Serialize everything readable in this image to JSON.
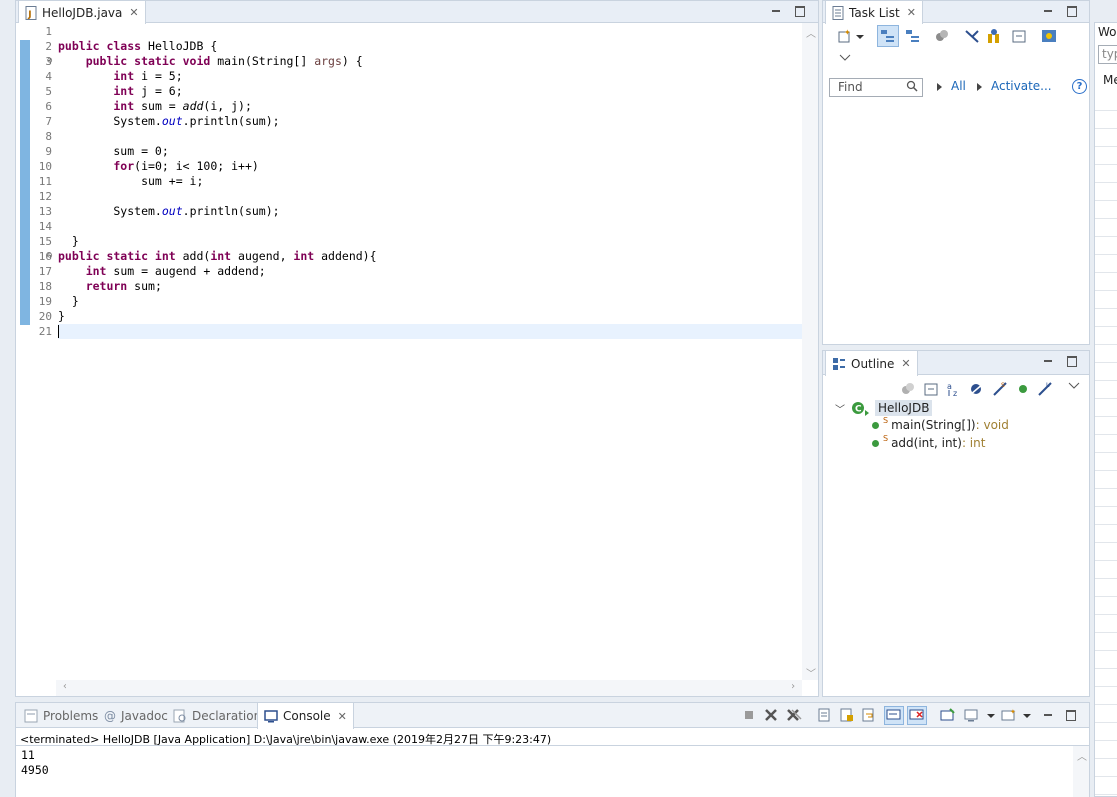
{
  "editor": {
    "tab_label": "HelloJDB.java",
    "line_numbers": [
      "1",
      "2",
      "3",
      "4",
      "5",
      "6",
      "7",
      "8",
      "9",
      "10",
      "11",
      "12",
      "13",
      "14",
      "15",
      "16",
      "17",
      "18",
      "19",
      "20",
      "21"
    ],
    "code": {
      "l2a": "public class",
      "l2b": " HelloJDB {",
      "l3a": "    public static void",
      "l3b": " main(String[] ",
      "l3c": "args",
      "l3d": ") {",
      "l4a": "        int",
      "l4b": " i = 5;",
      "l5a": "        int",
      "l5b": " j = 6;",
      "l6a": "        int",
      "l6b": " sum = ",
      "l6c": "add",
      "l6d": "(i, j);",
      "l7a": "        System.",
      "l7b": "out",
      "l7c": ".println(sum);",
      "l9": "        sum = 0;",
      "l10a": "        for",
      "l10b": "(i=0; i< 100; i++)",
      "l11": "            sum += i;",
      "l13a": "        System.",
      "l13b": "out",
      "l13c": ".println(sum);",
      "l15": "  }",
      "l16a": "public static int",
      "l16b": " add(",
      "l16c": "int",
      "l16d": " augend, ",
      "l16e": "int",
      "l16f": " addend){",
      "l17a": "    int",
      "l17b": " sum = augend + addend;",
      "l18a": "    return",
      "l18b": " sum;",
      "l19": "  }",
      "l20": "}"
    }
  },
  "task_list": {
    "tab_label": "Task List",
    "find_placeholder": "Find",
    "filter_all": "All",
    "filter_activate": "Activate..."
  },
  "outline": {
    "tab_label": "Outline",
    "class_name": "HelloJDB",
    "members": [
      {
        "name": "main(String[])",
        "ret": " : void",
        "modifier": "S"
      },
      {
        "name": "add(int, int)",
        "ret": " : int",
        "modifier": "S"
      }
    ]
  },
  "far_right": {
    "label_1": "Wor",
    "input_placeholder": "typ",
    "label_2": "Me"
  },
  "bottom": {
    "tabs": [
      "Problems",
      "Javadoc",
      "Declaration",
      "Console"
    ],
    "console_status": "<terminated> HelloJDB [Java Application] D:\\Java\\jre\\bin\\javaw.exe (2019年2月27日 下午9:23:47)",
    "output": [
      "11",
      "4950"
    ]
  },
  "colors": {
    "keyword": "#7f0055",
    "field": "#0000c0",
    "change_bar": "#5fa3d9",
    "link": "#1a66b8"
  }
}
